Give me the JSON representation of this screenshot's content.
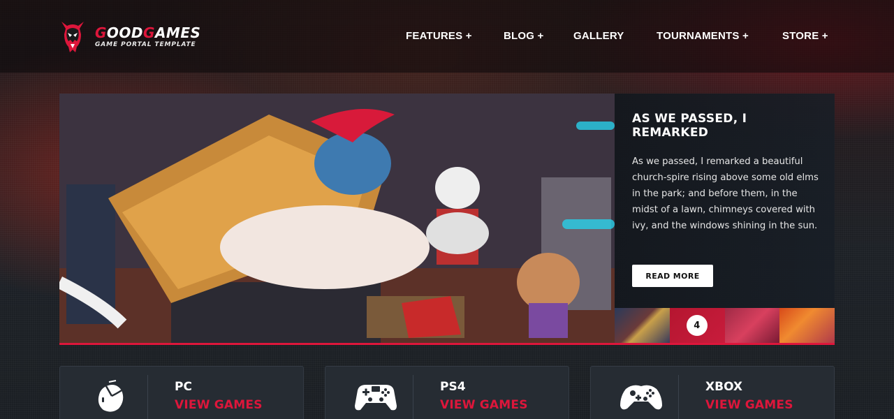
{
  "brand": {
    "name_part1_red": "G",
    "name_part1": "OOD",
    "name_part2_red": "G",
    "name_part2": "AMES",
    "tagline": "GAME PORTAL TEMPLATE"
  },
  "nav": {
    "items": [
      {
        "label": "FEATURES +"
      },
      {
        "label": "BLOG +"
      },
      {
        "label": "GALLERY"
      },
      {
        "label": "TOURNAMENTS +"
      },
      {
        "label": "STORE +"
      }
    ]
  },
  "slider": {
    "title": "AS WE PASSED, I REMARKED",
    "text": "As we passed, I remarked a beautiful church-spire rising above some old elms in the park; and before them, in the midst of a lawn, chimneys covered with ivy, and the windows shining in the sun.",
    "button_label": "READ MORE",
    "active_thumb_label": "4"
  },
  "platforms": [
    {
      "name": "PC",
      "link": "VIEW GAMES",
      "icon": "mouse-icon"
    },
    {
      "name": "PS4",
      "link": "VIEW GAMES",
      "icon": "gamepad-icon"
    },
    {
      "name": "XBOX",
      "link": "VIEW GAMES",
      "icon": "xbox-controller-icon"
    }
  ],
  "colors": {
    "accent": "#dd163b",
    "card_bg": "#262c33",
    "header_bg": "#0a080a"
  }
}
